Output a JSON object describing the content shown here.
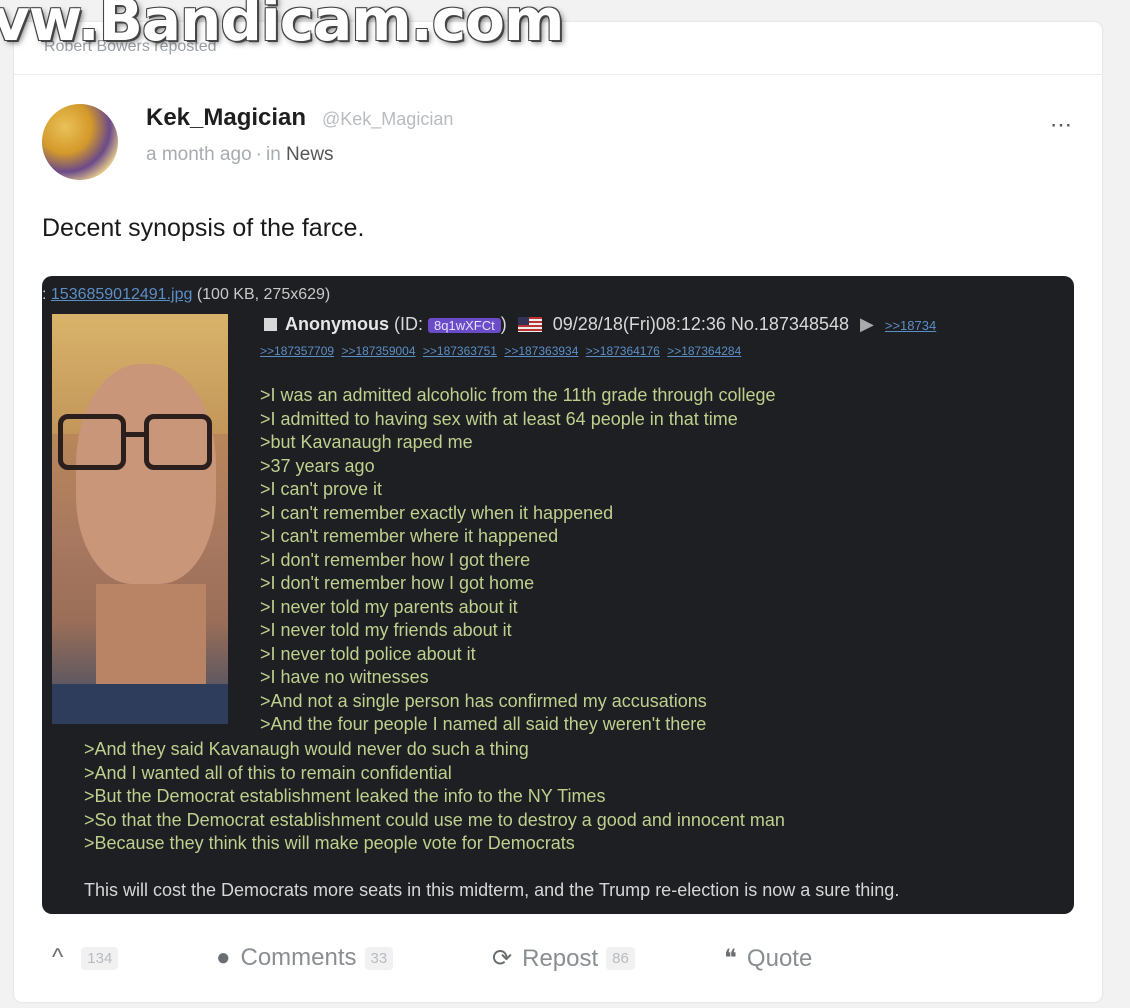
{
  "watermark": "vw.Bandicam.com",
  "reposted_line": "Robert Bowers reposted",
  "post": {
    "author_name": "Kek_Magician",
    "author_handle": "@Kek_Magician",
    "time": "a month ago",
    "separator": "·",
    "in_label": "in",
    "channel": "News",
    "more_icon": "⋯",
    "text": "Decent synopsis of the farce."
  },
  "embed": {
    "file_prefix": ": ",
    "file_name": "1536859012491.jpg",
    "file_info": "(100 KB, 275x629)",
    "poster_name": "Anonymous",
    "id_label_open": "(ID:",
    "poster_id": "8q1wXFCt",
    "id_label_close": ")",
    "datetime_no": "09/28/18(Fri)08:12:36 No.187348548",
    "arrow": "▶",
    "header_link": ">>18734",
    "reply_links": [
      ">>187357709",
      ">>187359004",
      ">>187363751",
      ">>187363934",
      ">>187364176",
      ">>187364284"
    ],
    "lines_right": [
      ">I was an admitted alcoholic from the 11th grade through college",
      ">I admitted to having sex with at least 64 people in that time",
      ">but Kavanaugh raped me",
      ">37 years ago",
      ">I can't prove it",
      ">I can't remember exactly when it happened",
      ">I can't remember where it happened",
      ">I don't remember how I got there",
      ">I don't remember how I got home",
      ">I never told my parents about it",
      ">I never told my friends about it",
      ">I never told police about it",
      ">I have no witnesses",
      ">And not a single person has confirmed my accusations",
      ">And the four people I named all said they weren't there"
    ],
    "lines_left": [
      ">And they said Kavanaugh would never do such a thing",
      ">And I wanted all of this to remain confidential",
      ">But the Democrat establishment leaked the info to the NY Times",
      ">So that the Democrat establishment could use me to destroy a good and innocent man",
      ">Because they think this will make people vote for Democrats"
    ],
    "closing": "This will cost the Democrats more seats in this midterm, and the Trump re-election is now a sure thing."
  },
  "actions": {
    "upvote_icon": "^",
    "upvote_count": "134",
    "comments_icon": "●",
    "comments_label": "Comments",
    "comments_count": "33",
    "repost_icon": "⟳",
    "repost_label": "Repost",
    "repost_count": "86",
    "quote_icon": "❝",
    "quote_label": "Quote"
  }
}
